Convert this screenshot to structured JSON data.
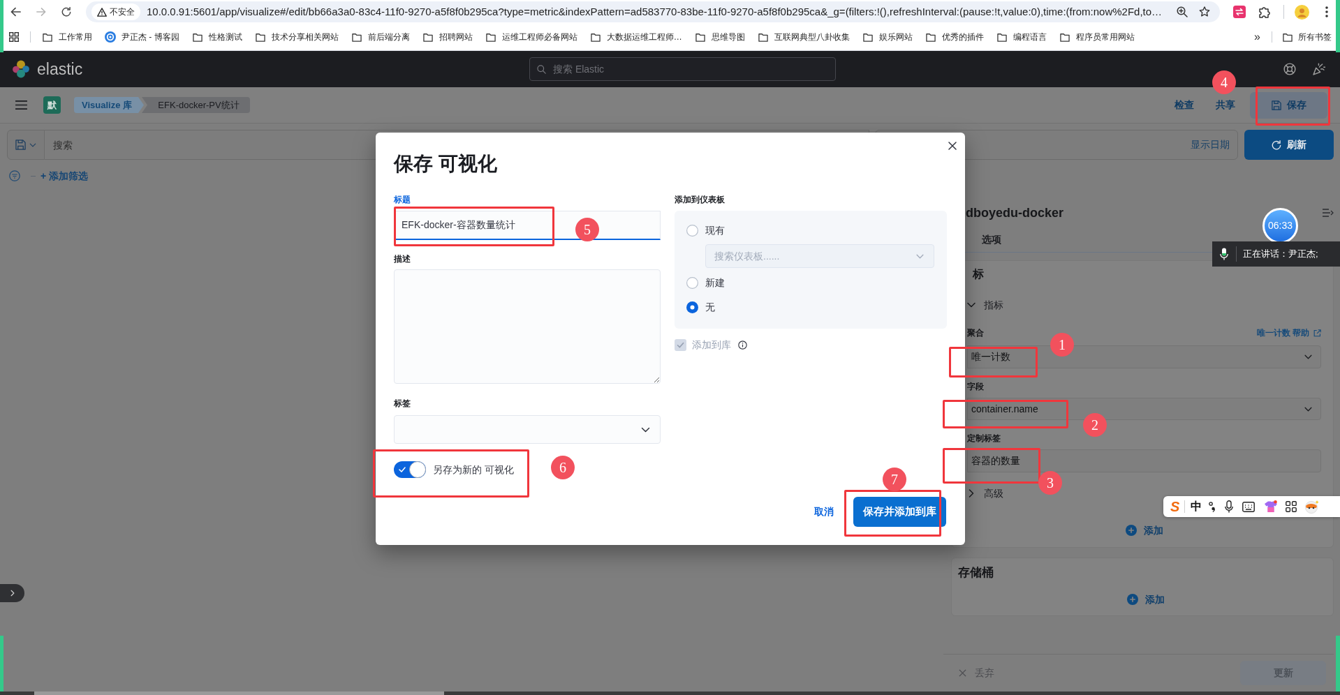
{
  "browser": {
    "security_label": "不安全",
    "url": "10.0.0.91:5601/app/visualize#/edit/bb66a3a0-83c4-11f0-9270-a5f8f0b295ca?type=metric&indexPattern=ad583770-83be-11f0-9270-a5f8f0b295ca&_g=(filters:!(),refreshInterval:(pause:!t,value:0),time:(from:now%2Fd,to…",
    "bookmarks": [
      {
        "label": "工作常用",
        "kind": "folder"
      },
      {
        "label": "尹正杰 - 博客园",
        "kind": "site"
      },
      {
        "label": "性格测试",
        "kind": "folder"
      },
      {
        "label": "技术分享相关网站",
        "kind": "folder"
      },
      {
        "label": "前后端分离",
        "kind": "folder"
      },
      {
        "label": "招聘网站",
        "kind": "folder"
      },
      {
        "label": "运维工程师必备网站",
        "kind": "folder"
      },
      {
        "label": "大数据运维工程师…",
        "kind": "folder"
      },
      {
        "label": "思维导图",
        "kind": "folder"
      },
      {
        "label": "互联网典型八卦收集",
        "kind": "folder"
      },
      {
        "label": "娱乐网站",
        "kind": "folder"
      },
      {
        "label": "优秀的插件",
        "kind": "folder"
      },
      {
        "label": "编程语言",
        "kind": "folder"
      },
      {
        "label": "程序员常用网站",
        "kind": "folder"
      }
    ],
    "more_bookmarks": "»",
    "all_bookmarks": "所有书签"
  },
  "header": {
    "logo_text": "elastic",
    "search_placeholder": "搜索 Elastic"
  },
  "app_bar": {
    "space_initial": "默",
    "breadcrumbs": [
      {
        "label": "Visualize 库",
        "kind": "link"
      },
      {
        "label": "EFK-docker-PV统计",
        "kind": "current"
      }
    ],
    "actions": [
      {
        "label": "检查",
        "kind": "link"
      },
      {
        "label": "共享",
        "kind": "link"
      },
      {
        "label": "保存",
        "kind": "button"
      }
    ]
  },
  "query_bar": {
    "search_placeholder": "搜索",
    "date_label": "显示日期",
    "refresh_button": "刷新"
  },
  "filter_bar": {
    "add_filter": "+ 添加筛选"
  },
  "side_panel": {
    "title": "dboyedu-docker",
    "tabs": [
      {
        "label": "选项",
        "selected": false
      }
    ],
    "metrics": {
      "title": "标",
      "accordion": {
        "label": "指标",
        "expanded": true
      },
      "fields": [
        {
          "kind": "select",
          "label": "聚合",
          "value": "唯一计数",
          "help_link": "唯一计数 帮助"
        },
        {
          "kind": "select",
          "label": "字段",
          "value": "container.name"
        },
        {
          "kind": "text",
          "label": "定制标签",
          "value": "容器的数量"
        }
      ],
      "advanced": {
        "label": "高级",
        "expanded": false
      },
      "add_button": "添加"
    },
    "buckets": {
      "title": "存储桶",
      "add_button": "添加"
    },
    "footer": {
      "discard_button": "丢弃",
      "update_button": "更新"
    }
  },
  "modal": {
    "title": "保存 可视化",
    "title_field": {
      "label": "标题",
      "value": "EFK-docker-容器数量统计"
    },
    "description": {
      "label": "描述"
    },
    "tags": {
      "label": "标签"
    },
    "save_as_new": {
      "label": "另存为新的 可视化",
      "on": true
    },
    "dashboard": {
      "label": "添加到仪表板",
      "options": [
        {
          "label": "现有",
          "selected": false
        },
        {
          "label": "新建",
          "selected": false
        },
        {
          "label": "无",
          "selected": true
        }
      ],
      "search_placeholder": "搜索仪表板......"
    },
    "add_to_library": {
      "label": "添加到库",
      "checked": true,
      "disabled": true
    },
    "cancel_button": "取消",
    "confirm_button": "保存并添加到库"
  },
  "overlays": {
    "timer": "06:33",
    "speaking": "正在讲话：尹正杰;",
    "ime": {
      "logo": "S",
      "mode": "中"
    }
  },
  "annotations": [
    {
      "number": "1"
    },
    {
      "number": "2"
    },
    {
      "number": "3"
    },
    {
      "number": "4"
    },
    {
      "number": "5"
    },
    {
      "number": "6"
    },
    {
      "number": "7"
    }
  ]
}
